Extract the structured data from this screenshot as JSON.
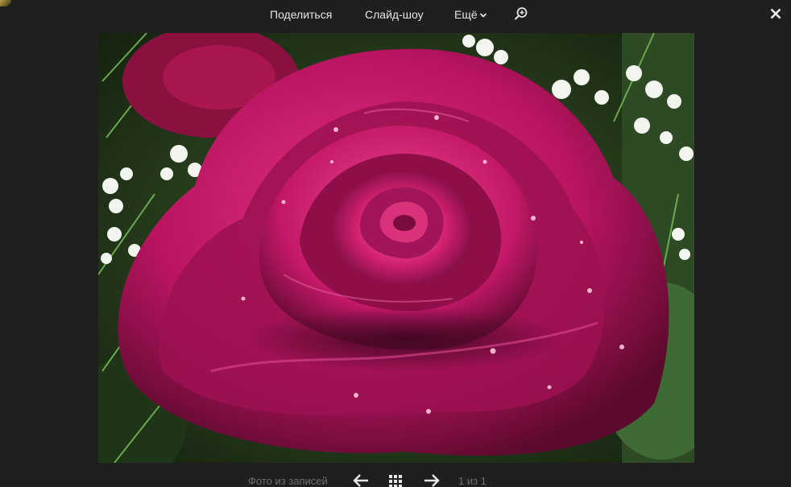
{
  "topbar": {
    "share_label": "Поделиться",
    "slideshow_label": "Слайд-шоу",
    "more_label": "Ещё"
  },
  "photo": {
    "subject": "crimson rose with water droplets"
  },
  "bottombar": {
    "source_label": "Фото из записей",
    "counter": "1 из 1"
  },
  "icons": {
    "more": "chevron-down-icon",
    "zoom": "zoom-in-icon",
    "close": "close-icon",
    "prev": "arrow-left-icon",
    "grid": "grid-icon",
    "next": "arrow-right-icon"
  },
  "colors": {
    "background": "#1f1f1f",
    "text_primary": "#e6e6e6",
    "text_muted": "#6f6f6f"
  }
}
